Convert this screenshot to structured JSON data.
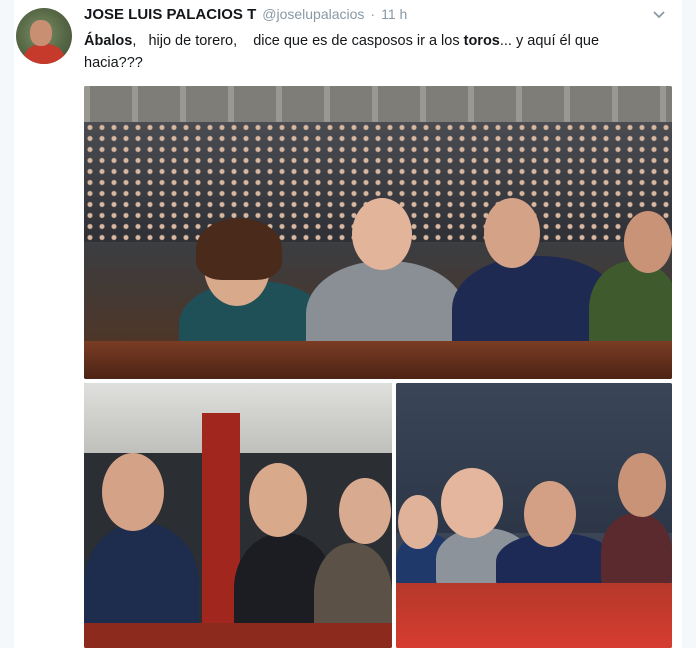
{
  "tweet": {
    "author_name": "JOSE LUIS PALACIOS T",
    "handle": "@joselupalacios",
    "separator": "·",
    "time": "11 h",
    "text_parts": [
      "Ábalos",
      ",   hijo de torero,    dice que es de casposos ir a los ",
      "toros",
      "... y aquí él que\nhacia???"
    ]
  },
  "icons": {
    "menu": "chevron-down-icon"
  },
  "colors": {
    "name": "#14171a",
    "meta": "#8899a6",
    "card_bg": "#ffffff",
    "page_bg": "#f5f8fa"
  }
}
